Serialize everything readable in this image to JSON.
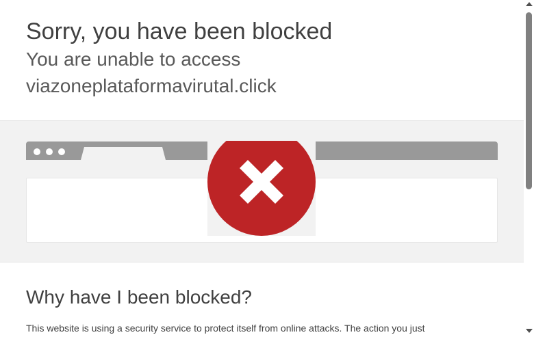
{
  "header": {
    "title": "Sorry, you have been blocked",
    "subtitle_line1": "You are unable to access",
    "subtitle_line2": "viazoneplataformavirutal.click"
  },
  "illustration": {
    "block_icon": "x-circle-icon",
    "icon_color": "#bd2426",
    "bar_color": "#999999"
  },
  "section": {
    "heading": "Why have I been blocked?",
    "paragraph": "This website is using a security service to protect itself from online attacks. The action you just"
  }
}
